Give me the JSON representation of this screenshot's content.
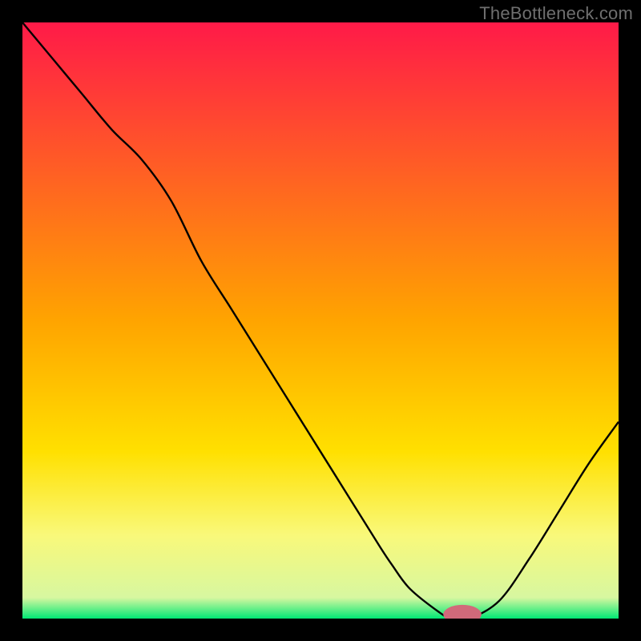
{
  "watermark": "TheBottleneck.com",
  "chart_data": {
    "type": "line",
    "title": "",
    "xlabel": "",
    "ylabel": "",
    "xlim": [
      0,
      100
    ],
    "ylim": [
      0,
      100
    ],
    "x": [
      0,
      5,
      10,
      15,
      20,
      25,
      30,
      35,
      40,
      45,
      50,
      55,
      60,
      62,
      65,
      70,
      72,
      75,
      80,
      85,
      90,
      95,
      100
    ],
    "values": [
      100,
      94,
      88,
      82,
      77,
      70,
      60,
      52,
      44,
      36,
      28,
      20,
      12,
      9,
      5,
      1,
      0,
      0,
      3,
      10,
      18,
      26,
      33
    ],
    "background_gradient": {
      "stops": [
        {
          "pos": 0.0,
          "color": "#ff1a48"
        },
        {
          "pos": 0.5,
          "color": "#ffa400"
        },
        {
          "pos": 0.72,
          "color": "#ffe000"
        },
        {
          "pos": 0.86,
          "color": "#f9f97a"
        },
        {
          "pos": 0.965,
          "color": "#d7f7a0"
        },
        {
          "pos": 1.0,
          "color": "#00e874"
        }
      ]
    },
    "marker": {
      "x": 73.8,
      "y": 0.7,
      "rx": 3.2,
      "ry": 1.6,
      "color": "#d1697a"
    },
    "line_color": "#000000",
    "line_width": 2.4
  }
}
